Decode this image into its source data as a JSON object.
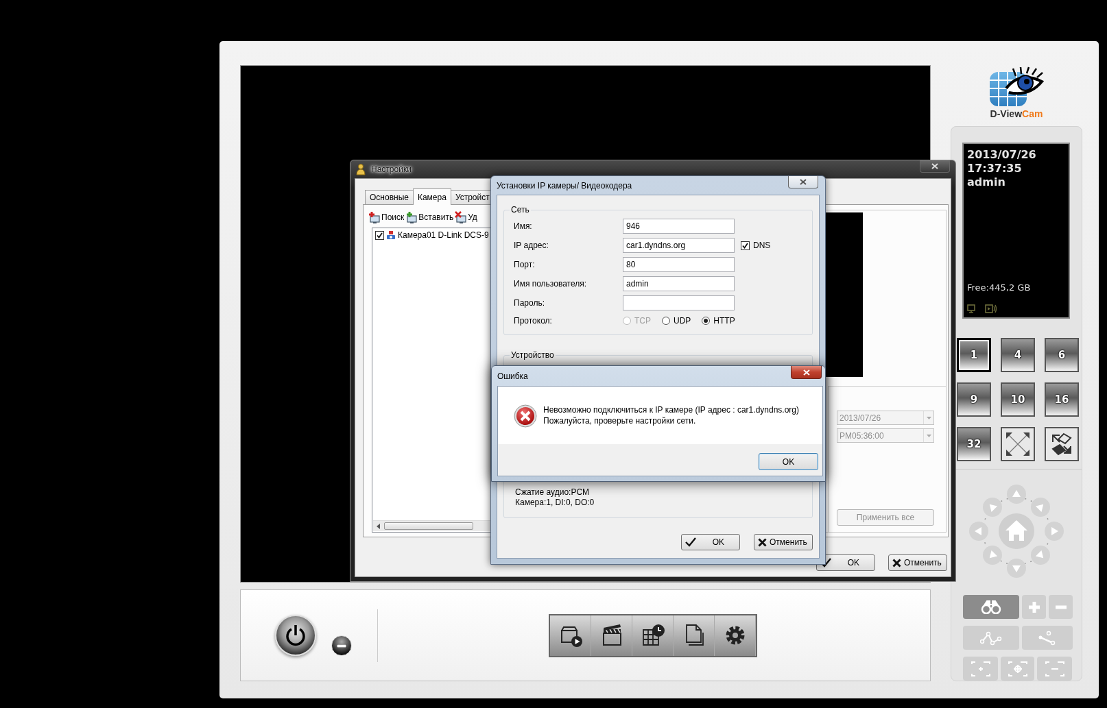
{
  "main_window": {
    "logo": {
      "name_part": "D-View",
      "accent_part": "Cam"
    },
    "status": {
      "date": "2013/07/26",
      "time": "17:37:35",
      "user": "admin",
      "free_space": "Free:445,2 GB"
    },
    "layouts": [
      {
        "kind": "split",
        "label": "1",
        "selected": true
      },
      {
        "kind": "split",
        "label": "4",
        "selected": false
      },
      {
        "kind": "split",
        "label": "6",
        "selected": false
      },
      {
        "kind": "split",
        "label": "9",
        "selected": false
      },
      {
        "kind": "split",
        "label": "10",
        "selected": false
      },
      {
        "kind": "split",
        "label": "16",
        "selected": false
      },
      {
        "kind": "split",
        "label": "32",
        "selected": false
      },
      {
        "kind": "fullscreen",
        "selected": false
      },
      {
        "kind": "swap",
        "selected": false
      }
    ],
    "ptz_tools": [
      {
        "kind": "binoculars",
        "selected": true
      },
      {
        "kind": "zoom_in",
        "selected": false
      },
      {
        "kind": "zoom_out",
        "selected": false
      }
    ]
  },
  "settings_window": {
    "title": "Настройки",
    "tabs": [
      {
        "label": "Основные",
        "selected": false
      },
      {
        "label": "Камера",
        "selected": true
      },
      {
        "label": "Устройст",
        "selected": false
      }
    ],
    "toolbar": [
      {
        "kind": "search",
        "label": "Поиск"
      },
      {
        "kind": "insert",
        "label": "Вставить"
      },
      {
        "kind": "delete",
        "label": "Уд"
      }
    ],
    "cameras": [
      {
        "label": "Камера01 D-Link DCS-9",
        "checked": true
      }
    ],
    "date_field": {
      "value": "2013/07/26",
      "disabled": true
    },
    "time_field": {
      "value": "PM05:36:00",
      "disabled": true
    },
    "apply_button": {
      "label": "Применить все",
      "disabled": true
    },
    "buttons": [
      {
        "kind": "ok",
        "label": "OK"
      },
      {
        "kind": "cancel",
        "label": "Отменить"
      }
    ]
  },
  "ip_camera_dialog": {
    "title": "Установки IP камеры/ Видеокодера",
    "network_group": {
      "title": "Сеть",
      "fields": [
        {
          "label": "Имя:",
          "value": "946"
        },
        {
          "label": "IP адрес:",
          "value": "car1.dyndns.org"
        },
        {
          "label": "Порт:",
          "value": "80"
        },
        {
          "label": "Имя пользователя:",
          "value": "admin"
        },
        {
          "label": "Пароль:"
        }
      ],
      "dns": {
        "label": "DNS",
        "checked": true
      },
      "protocol_label": "Протокол:",
      "protocols": [
        {
          "label": "TCP",
          "selected": false,
          "disabled": true
        },
        {
          "label": "UDP",
          "selected": false,
          "disabled": false
        },
        {
          "label": "HTTP",
          "selected": true,
          "disabled": false
        }
      ]
    },
    "device_group": {
      "title": "Устройство",
      "lines": [
        "Сжатие аудио:PCM",
        "Камера:1, DI:0, DO:0"
      ]
    },
    "buttons": [
      {
        "kind": "ok",
        "label": "OK"
      },
      {
        "kind": "cancel",
        "label": "Отменить"
      }
    ]
  },
  "error_dialog": {
    "title": "Ошибка",
    "message": [
      "Невозможно подключиться к IP камере (IP адрес : car1.dyndns.org)",
      "Пожалуйста, проверьте настройки сети."
    ],
    "button": "OK"
  }
}
